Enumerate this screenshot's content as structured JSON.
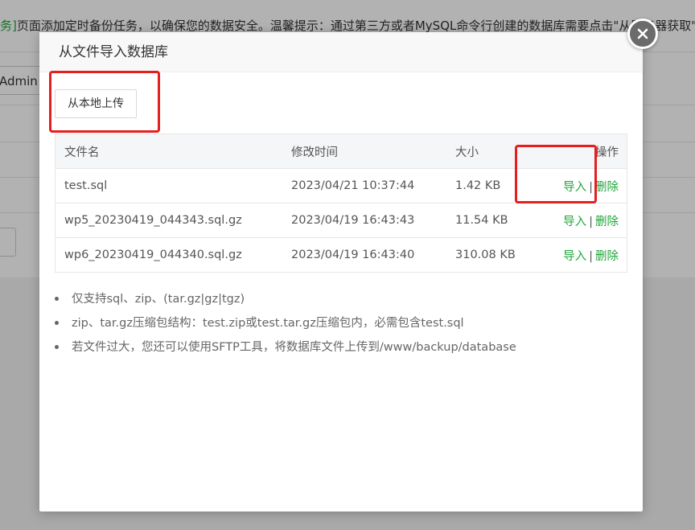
{
  "background": {
    "notice_prefix": "务]",
    "notice_text": "页面添加定时备份任务，以确保您的数据安全。温馨提示：通过第三方或者MySQL命令行创建的数据库需要点击\"从服务器获取\"",
    "admin_text": "Admin",
    "small_btn_text": "作"
  },
  "modal": {
    "title": "从文件导入数据库",
    "upload_button": "从本地上传",
    "table": {
      "headers": {
        "name": "文件名",
        "time": "修改时间",
        "size": "大小",
        "ops": "操作"
      },
      "rows": [
        {
          "name": "test.sql",
          "time": "2023/04/21 10:37:44",
          "size": "1.42 KB",
          "import": "导入",
          "sep": "|",
          "delete": "删除"
        },
        {
          "name": "wp5_20230419_044343.sql.gz",
          "time": "2023/04/19 16:43:43",
          "size": "11.54 KB",
          "import": "导入",
          "sep": "|",
          "delete": "删除"
        },
        {
          "name": "wp6_20230419_044340.sql.gz",
          "time": "2023/04/19 16:43:40",
          "size": "310.08 KB",
          "import": "导入",
          "sep": "|",
          "delete": "删除"
        }
      ]
    },
    "tips": [
      "仅支持sql、zip、(tar.gz|gz|tgz)",
      "zip、tar.gz压缩包结构：test.zip或test.tar.gz压缩包内，必需包含test.sql",
      "若文件过大，您还可以使用SFTP工具，将数据库文件上传到/www/backup/database"
    ]
  },
  "icons": {
    "close": "close-icon"
  },
  "colors": {
    "link_green": "#20a53a",
    "annotation_red": "#e61e1e",
    "close_button": "#6b6b6b"
  }
}
